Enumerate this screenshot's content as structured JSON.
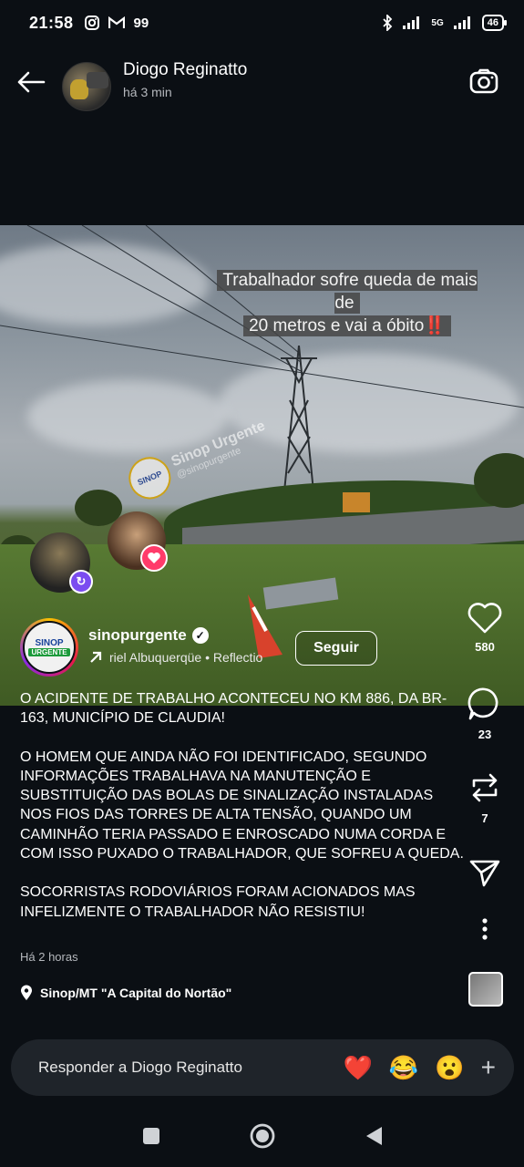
{
  "status_bar": {
    "time": "21:58",
    "left_icons": [
      "instagram-icon",
      "gmail-icon",
      "99-app-icon"
    ],
    "app_label_99": "99",
    "network_label": "5G",
    "battery": "46"
  },
  "header": {
    "user_name": "Diogo Reginatto",
    "time_ago": "há 3 min"
  },
  "image": {
    "overlay_line1": "Trabalhador sofre queda de mais de",
    "overlay_line2": "20 metros e vai a óbito‼️",
    "watermark_text": "Sinop Urgente",
    "watermark_sub": "@sinopurgente",
    "watermark_logo_top": "SINOP",
    "watermark_logo_bottom": "URGENTE"
  },
  "post": {
    "author": "sinopurgente",
    "author_logo_top": "SINOP",
    "author_logo_bottom": "URGENTE",
    "music": "riel Albuquerqüe • Reflectio",
    "follow_label": "Seguir",
    "caption": [
      "O ACIDENTE DE TRABALHO ACONTECEU NO KM 886, DA BR-163, MUNICÍPIO DE CLAUDIA!",
      "O HOMEM QUE AINDA NÃO FOI IDENTIFICADO, SEGUNDO INFORMAÇÕES TRABALHAVA NA MANUTENÇÃO E SUBSTITUIÇÃO DAS BOLAS DE SINALIZAÇÃO INSTALADAS NOS FIOS DAS TORRES DE ALTA TENSÃO, QUANDO UM CAMINHÃO TERIA PASSADO E ENROSCADO NUMA CORDA E COM ISSO PUXADO O TRABALHADOR, QUE SOFREU A QUEDA.",
      "SOCORRISTAS RODOVIÁRIOS FORAM ACIONADOS MAS INFELIZMENTE O TRABALHADOR NÃO RESISTIU!"
    ],
    "time_ago": "Há 2 horas",
    "location": "Sinop/MT \"A Capital do Nortão\""
  },
  "actions": {
    "likes": "580",
    "comments": "23",
    "reposts": "7"
  },
  "reply": {
    "placeholder": "Responder a Diogo Reginatto",
    "emojis": [
      "❤️",
      "😂",
      "😮"
    ],
    "plus": "+"
  },
  "colors": {
    "background": "#0b0f14",
    "reply_bar": "#1f242a",
    "heart_red": "#e8263e",
    "mention_purple": "#7b4cf0",
    "mention_pink": "#ff3b6a"
  }
}
